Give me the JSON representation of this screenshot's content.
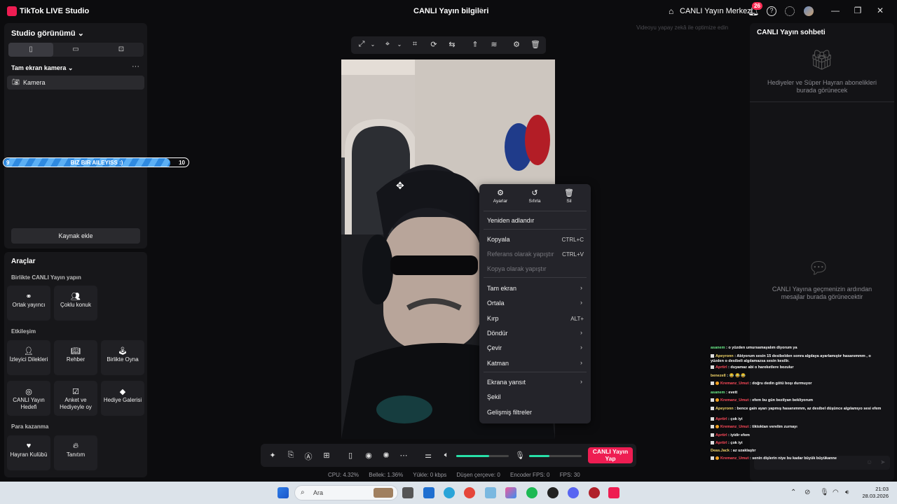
{
  "titlebar": {
    "app_name": "TikTok LIVE Studio",
    "center_title": "CANLI Yayın bilgileri",
    "live_center": "CANLI Yayın Merkezi",
    "notification_count": "26",
    "help": "?",
    "minimize": "—",
    "maximize": "❐",
    "close": "✕"
  },
  "left": {
    "studio_view": "Studio görünümü",
    "orientations": [
      "▯",
      "▭",
      "⊡"
    ],
    "scene_name": "Tam ekran kamera",
    "more": "···",
    "source_label": "Kamera",
    "add_source": "Kaynak ekle"
  },
  "progress": {
    "left": "9",
    "title": "BIZ BIR AILEYISS :)",
    "right": "10",
    "fill_fraction": 0.9
  },
  "tools": {
    "heading": "Araçlar",
    "live_together": "Birlikte CANLI Yayın yapın",
    "cohost": "Ortak yayıncı",
    "multi_guest": "Çoklu konuk",
    "interaction": "Etkileşim",
    "viewer_requests": "İzleyici Dilekleri",
    "guide": "Rehber",
    "play_together": "Birlikte Oyna",
    "live_goal": "CANLI Yayın Hedefi",
    "poll": "Anket ve Hediyeyle oy",
    "gift_gallery": "Hediye Galerisi",
    "monetize": "Para kazanma",
    "fan_club": "Hayran Kulübü",
    "promote": "Tanıtım"
  },
  "watermark": "Videoyu yapay zekâ ile optimize edin",
  "context_menu": {
    "top": [
      {
        "icon": "⚙",
        "label": "Ayarlar"
      },
      {
        "icon": "↺",
        "label": "Sıfırla"
      },
      {
        "icon": "🗑",
        "label": "Sil"
      }
    ],
    "rename": "Yeniden adlandır",
    "copy": "Kopyala",
    "copy_sc": "CTRL+C",
    "paste_ref": "Referans olarak yapıştır",
    "paste_ref_sc": "CTRL+V",
    "paste_copy": "Kopya olarak yapıştır",
    "fullscreen": "Tam ekran",
    "center": "Ortala",
    "crop": "Kırp",
    "crop_sc": "ALT+",
    "rotate": "Döndür",
    "flip": "Çevir",
    "layer": "Katman",
    "project": "Ekrana yansıt",
    "shape": "Şekil",
    "filters": "Gelişmiş filtreler",
    "arrow": "›"
  },
  "bottombar": {
    "go_live": "CANLI Yayın Yap",
    "volume_level": 0.62,
    "mic_level": 0.38
  },
  "stats": {
    "cpu": "CPU:  4.32%",
    "memory": "Bellek:  1.36%",
    "upload": "Yükle:  0 kbps",
    "dropped": "Düşen çerçeve:  0",
    "encoder": "Encoder FPS:  0",
    "fps": "FPS:  30"
  },
  "chat": {
    "title": "CANLI Yayın sohbeti",
    "gift_text": "Hediyeler ve Süper Hayran abonelikleri burada görünecek",
    "empty_text": "CANLI Yayına geçmenizin ardından mesajlar burada görünecektir"
  },
  "overlay_chat": [
    {
      "name": "asanem",
      "text": ": o yüzden umursamayalım diyorum ya",
      "c": "g",
      "b": ""
    },
    {
      "name": "Apeyronn",
      "text": ": Abiyorum sesin 15 desibelden sonra algılaya ayarlamıştır hasanımmm , o yüzden o desibeli algılamazsa sesin kesilir.",
      "c": "y",
      "b": "w"
    },
    {
      "name": "Aprtirl",
      "text": ": duyamaz abi o hareketlere bozulur",
      "c": "r",
      "b": "w"
    },
    {
      "name": "benezell",
      "text": ": 😂 😂 😂",
      "c": "y",
      "b": ""
    },
    {
      "name": "Kremanz_Umut",
      "text": ": doğru dedin götü boşı durmuyor",
      "c": "r",
      "b": "wo"
    },
    {
      "name": "asanem",
      "text": ": evett",
      "c": "g",
      "b": ""
    },
    {
      "name": "Kremanz_Umut",
      "text": ": efem bu gün bezilyan bekliyorum",
      "c": "r",
      "b": "wo"
    },
    {
      "name": "Apeyronn",
      "text": ": bence gain ayarı yapmış hasanımmm, az desibel düşünce algılamıyo sesi efem",
      "c": "y",
      "b": "w"
    },
    {
      "name": "Aprtirl",
      "text": ": çok iyi",
      "c": "r",
      "b": "w"
    },
    {
      "name": "Kremanz_Umut",
      "text": ": tiktoktan verelim zurnayı",
      "c": "r",
      "b": "wo"
    },
    {
      "name": "Aprtirl",
      "text": ": iyidir efem",
      "c": "r",
      "b": "w"
    },
    {
      "name": "Aprtirl",
      "text": ": çok iyi",
      "c": "r",
      "b": "w"
    },
    {
      "name": "Deas.Jack",
      "text": ": az uzaklaştır",
      "c": "y",
      "b": ""
    },
    {
      "name": "Kremanz_Umut",
      "text": ": senin dişlerin niye bu kadar büyük büyükanne",
      "c": "r",
      "b": "wo"
    }
  ],
  "taskbar": {
    "search": "Ara",
    "time": "21:03",
    "date": "28.03.2026"
  },
  "colors": {
    "accent": "#ee1d52",
    "progress": "#2f8ae0",
    "meter": "#28e0a8"
  }
}
